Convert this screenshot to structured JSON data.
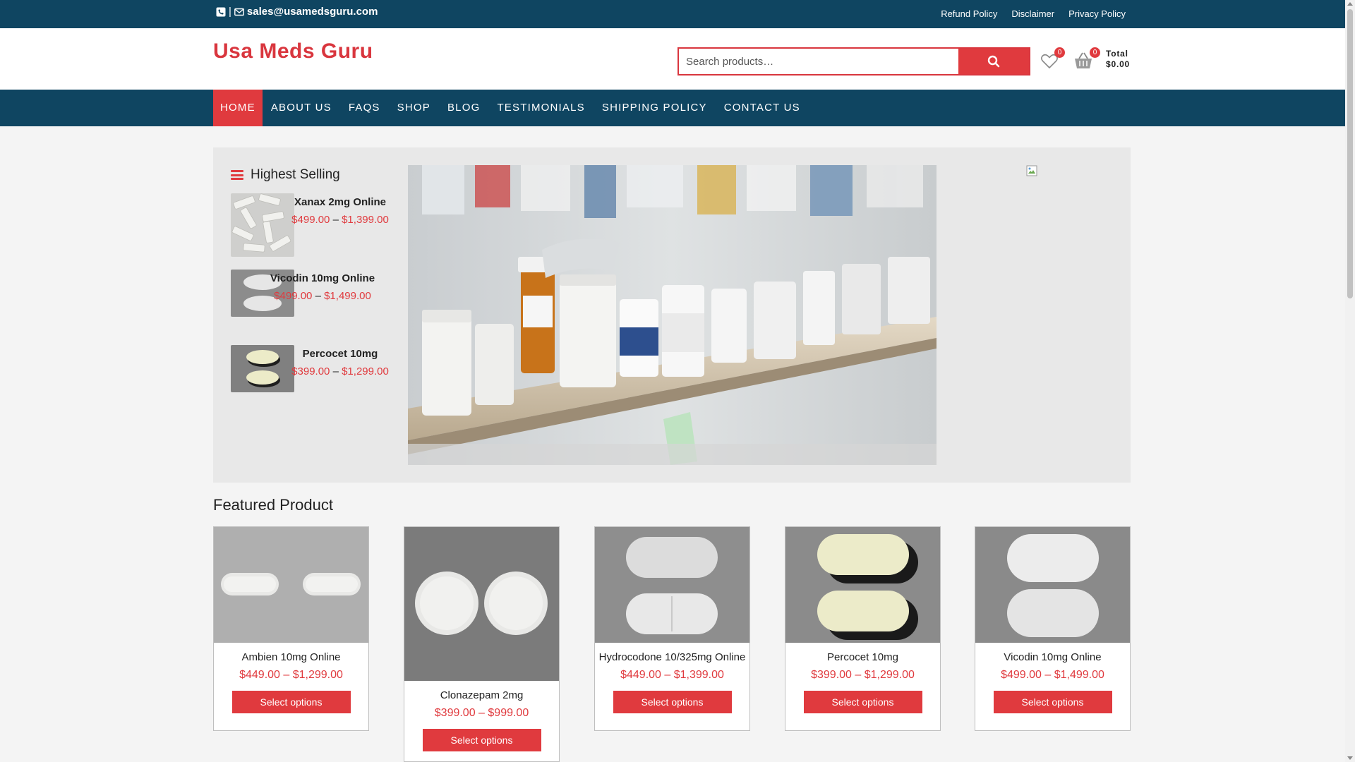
{
  "topbar": {
    "separator": "|",
    "email": "sales@usamedsguru.com",
    "links": [
      "Refund Policy",
      "Disclaimer",
      "Privacy Policy"
    ]
  },
  "header": {
    "logo": "Usa Meds Guru",
    "search_placeholder": "Search products…",
    "wishlist_count": "0",
    "cart_count": "0",
    "total_label": "Total",
    "total_value": "$0.00"
  },
  "nav": {
    "items": [
      "HOME",
      "ABOUT US",
      "FAQS",
      "SHOP",
      "BLOG",
      "TESTIMONIALS",
      "SHIPPING POLICY",
      "CONTACT US"
    ],
    "active": "HOME"
  },
  "sidebar": {
    "title": "Highest Selling",
    "items": [
      {
        "name": "Xanax 2mg Online",
        "price_low": "$499.00",
        "price_high": "$1,399.00"
      },
      {
        "name": "Vicodin 10mg Online",
        "price_low": "$499.00",
        "price_high": "$1,499.00"
      },
      {
        "name": "Percocet 10mg",
        "price_low": "$399.00",
        "price_high": "$1,299.00"
      }
    ]
  },
  "featured": {
    "title": "Featured Product",
    "products": [
      {
        "name": "Ambien 10mg Online",
        "price": "$449.00 – $1,299.00",
        "button": "Select options"
      },
      {
        "name": "Clonazepam 2mg",
        "price": "$399.00 – $999.00",
        "button": "Select options"
      },
      {
        "name": "Hydrocodone 10/325mg Online",
        "price": "$449.00 – $1,399.00",
        "button": "Select options"
      },
      {
        "name": "Percocet 10mg",
        "price": "$399.00 – $1,299.00",
        "button": "Select options"
      },
      {
        "name": "Vicodin 10mg Online",
        "price": "$499.00 – $1,499.00",
        "button": "Select options"
      }
    ]
  },
  "colors": {
    "navy": "#0f4561",
    "accent_red": "#e03a3e"
  }
}
